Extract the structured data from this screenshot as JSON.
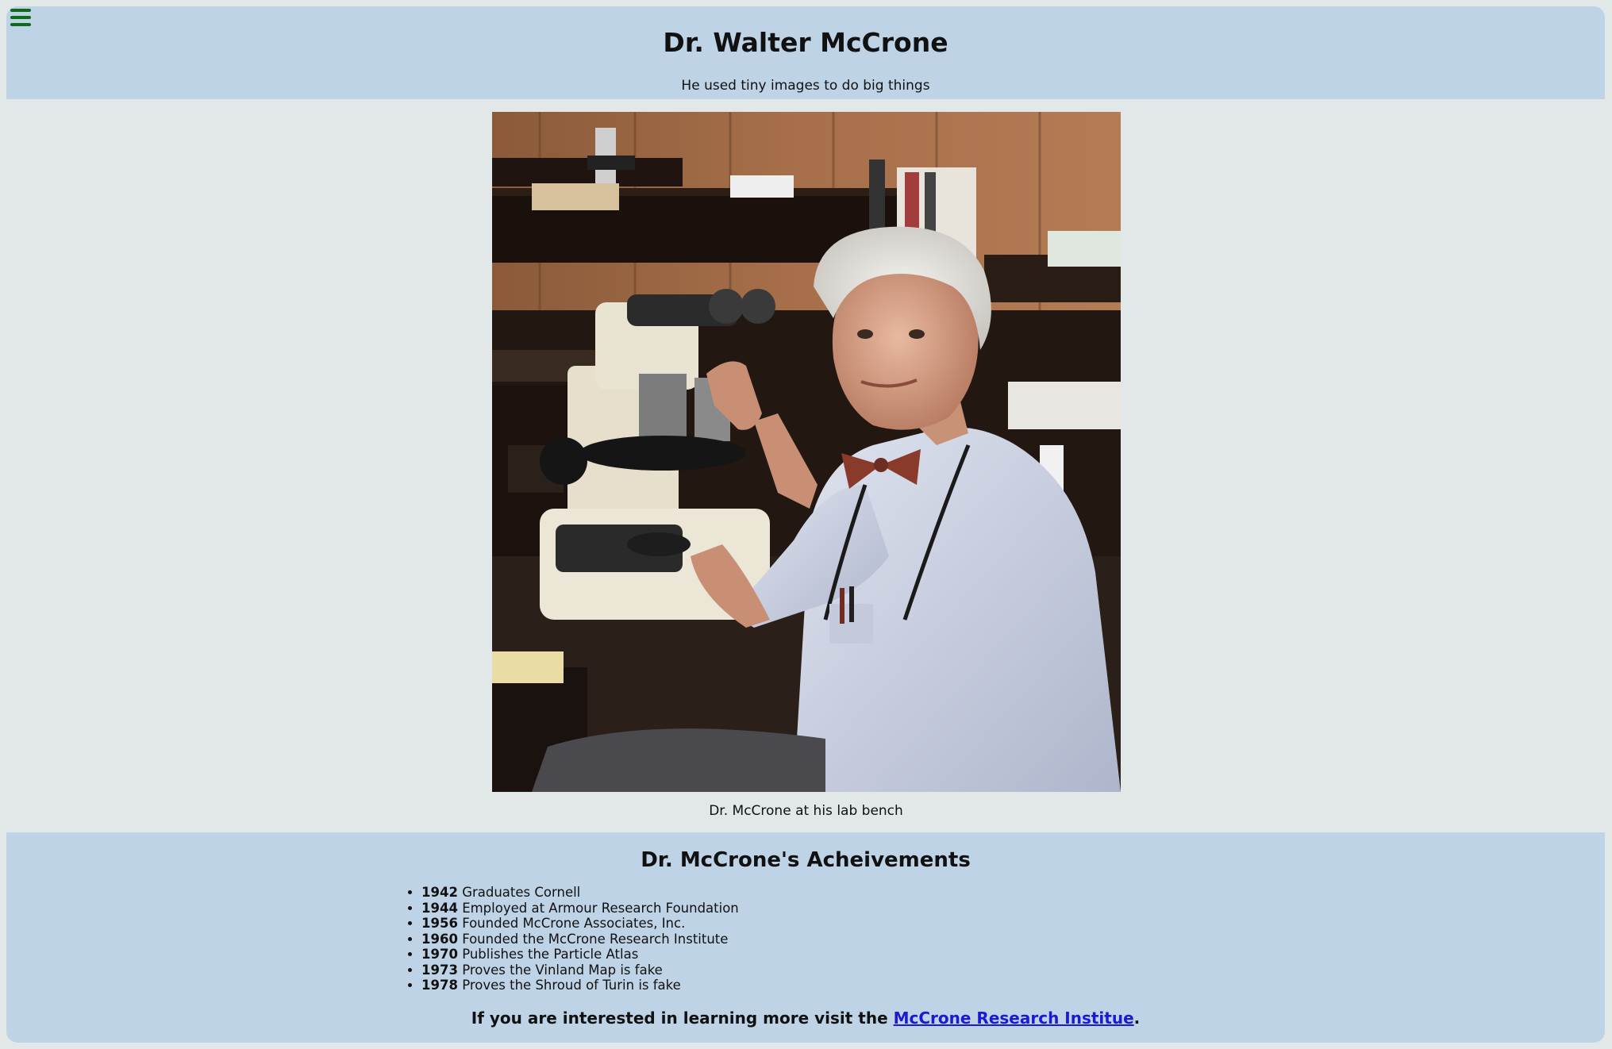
{
  "header": {
    "title": "Dr. Walter McCrone",
    "subtitle": "He used tiny images to do big things"
  },
  "figure": {
    "caption": "Dr. McCrone at his lab bench"
  },
  "achievements": {
    "heading": "Dr. McCrone's Acheivements",
    "items": [
      {
        "year": "1942",
        "text": "Graduates Cornell"
      },
      {
        "year": "1944",
        "text": "Employed at Armour Research Foundation"
      },
      {
        "year": "1956",
        "text": "Founded McCrone Associates, Inc."
      },
      {
        "year": "1960",
        "text": "Founded the McCrone Research Institute"
      },
      {
        "year": "1970",
        "text": "Publishes the Particle Atlas"
      },
      {
        "year": "1973",
        "text": "Proves the Vinland Map is fake"
      },
      {
        "year": "1978",
        "text": "Proves the Shroud of Turin is fake"
      }
    ]
  },
  "footer": {
    "visit_prefix": "If you are interested in learning more visit the ",
    "link_text": "McCrone Research Institue",
    "visit_suffix": "."
  },
  "icons": {
    "menu": "hamburger-menu-icon"
  },
  "colors": {
    "panel_background": "#bfd3e6",
    "page_background": "#e2e8e8",
    "menu_icon": "#0d6b1a",
    "link": "#1a1ad6"
  }
}
